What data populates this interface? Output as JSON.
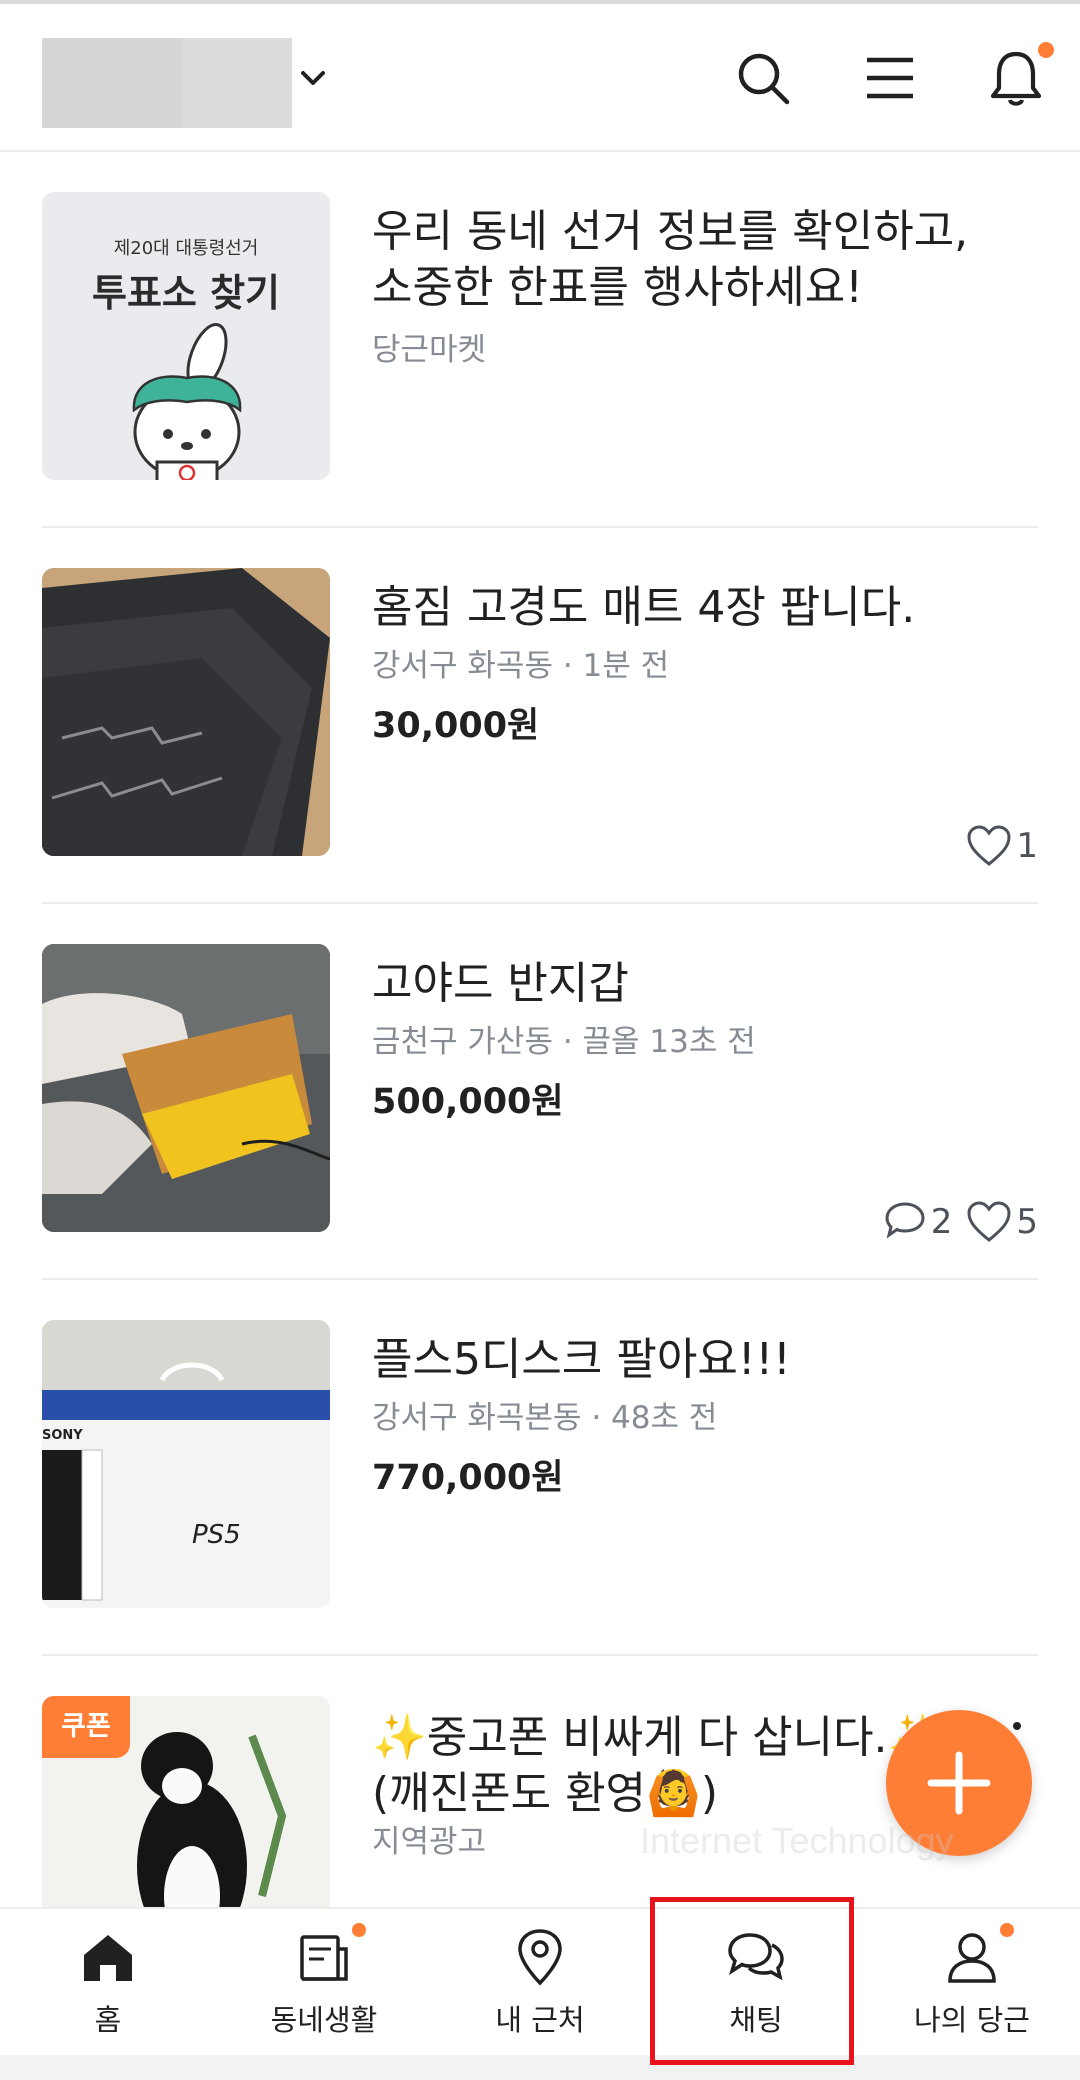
{
  "header": {
    "location_label": "",
    "icons": [
      "search-icon",
      "menu-icon",
      "bell-icon"
    ]
  },
  "feed": [
    {
      "kind": "ad",
      "thumb": {
        "overline": "제20대 대통령선거",
        "headline": "투표소 찾기"
      },
      "title": "우리 동네 선거 정보를 확인하고, 소중한 한표를 행사하세요!",
      "sub": "당근마켓"
    },
    {
      "kind": "product",
      "title": "홈짐 고경도 매트 4장 팝니다.",
      "sub": "강서구 화곡동 · 1분 전",
      "price": "30,000원",
      "likes": "1"
    },
    {
      "kind": "product",
      "title": "고야드 반지갑",
      "sub": "금천구 가산동 · 끌올 13초 전",
      "price": "500,000원",
      "chats": "2",
      "likes": "5"
    },
    {
      "kind": "product",
      "title": "플스5디스크 팔아요!!!",
      "sub": "강서구 화곡본동 · 48초 전",
      "price": "770,000원",
      "thumb": {
        "brand": "SONY",
        "logo": "PS5"
      }
    },
    {
      "kind": "coupon-ad",
      "badge": "쿠폰",
      "title_line1": "✨중고폰 비싸게 다 삽니다.✨",
      "title_line2": "(깨진폰도 환영🙆)",
      "sub": "지역광고"
    }
  ],
  "fab": {
    "icon": "plus-icon"
  },
  "watermark": "Internet Technology",
  "tabs": [
    {
      "label": "홈",
      "icon": "home-icon",
      "active": true
    },
    {
      "label": "동네생활",
      "icon": "neighborhood-icon",
      "dot": true
    },
    {
      "label": "내 근처",
      "icon": "location-pin-icon"
    },
    {
      "label": "채팅",
      "icon": "chat-icon"
    },
    {
      "label": "나의 당근",
      "icon": "profile-icon",
      "dot": true
    }
  ],
  "colors": {
    "accent": "#ff7e36",
    "highlight": "#e8141c",
    "text": "#212124",
    "subtext": "#868b94"
  }
}
